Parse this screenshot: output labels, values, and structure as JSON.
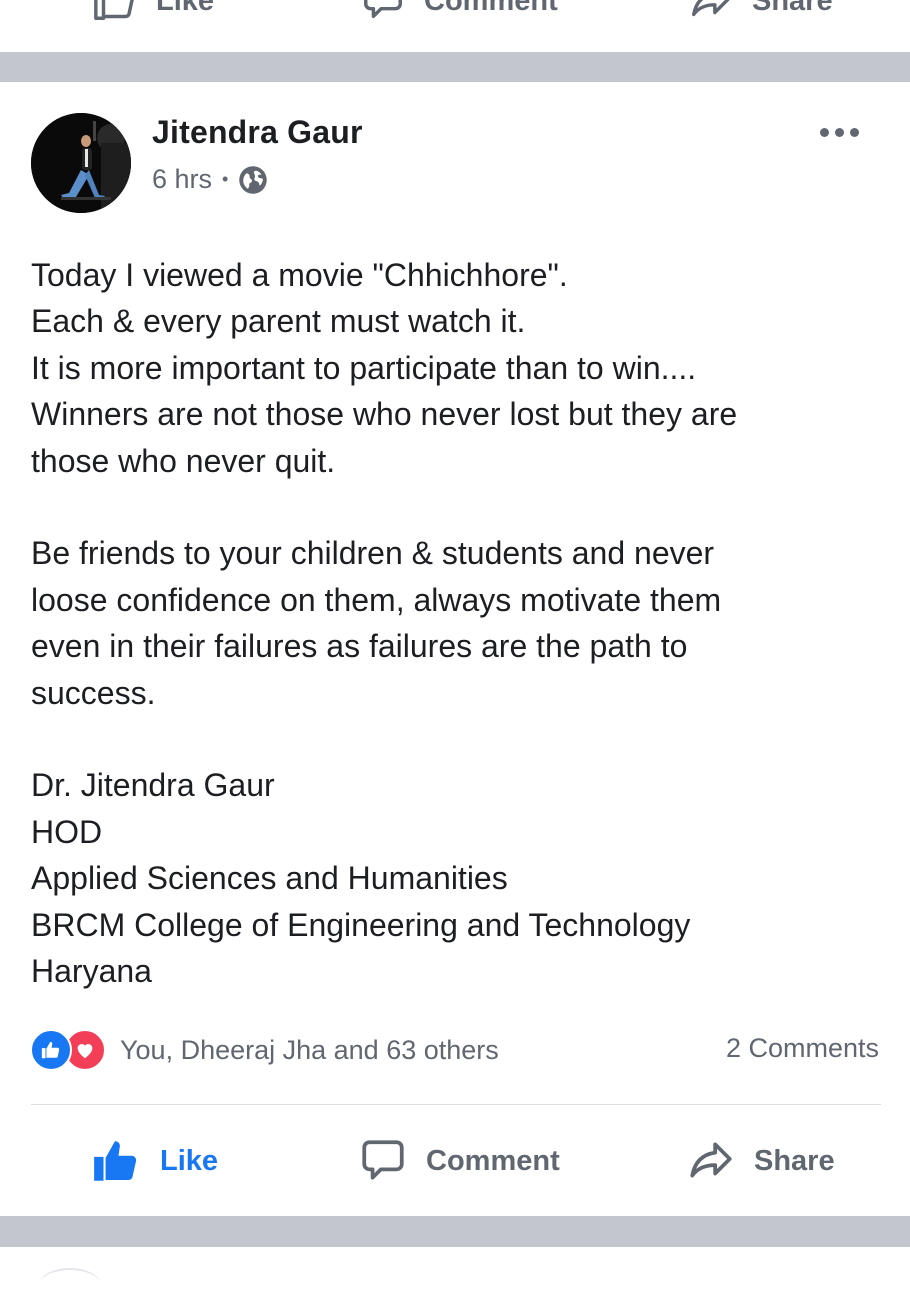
{
  "previous_post": {
    "actions": {
      "like_label": "Like",
      "comment_label": "Comment",
      "share_label": "Share"
    }
  },
  "post": {
    "author": "Jitendra Gaur",
    "time": "6 hrs",
    "time_separator": "•",
    "privacy_icon": "globe-icon",
    "text_lines": [
      "Today I viewed a movie \"Chhichhore\".",
      "Each & every parent must watch it.",
      "It is more important to participate than to win....",
      "Winners are not those who never lost but they are",
      "those who never quit.",
      "",
      "Be friends to your children & students and never",
      "loose confidence on them, always motivate them",
      "even in their failures as failures are the path to",
      "success.",
      "",
      "Dr. Jitendra Gaur",
      "HOD",
      "Applied Sciences and Humanities",
      "BRCM College of Engineering and Technology",
      "Haryana"
    ],
    "reactions": {
      "icons": [
        "like-reaction-icon",
        "love-reaction-icon"
      ],
      "summary": "You, Dheeraj Jha and 63 others"
    },
    "comments_count": "2 Comments",
    "actions": {
      "like_label": "Like",
      "comment_label": "Comment",
      "share_label": "Share"
    }
  },
  "colors": {
    "accent": "#1877f2",
    "love": "#f33e58",
    "separator": "#c3c6cc",
    "secondary_text": "#606770"
  }
}
